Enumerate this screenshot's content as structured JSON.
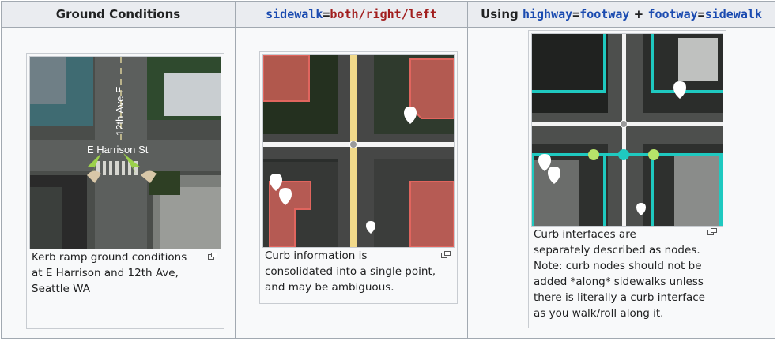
{
  "headers": {
    "col1": "Ground Conditions",
    "col2": {
      "key": "sidewalk",
      "eq": "=",
      "value": "both/right/left"
    },
    "col3": {
      "prefix": "Using ",
      "key1": "highway",
      "eq1": "=",
      "val1": "footway",
      "plus": " + ",
      "key2": "footway",
      "eq2": "=",
      "val2": "sidewalk"
    }
  },
  "figures": [
    {
      "street_label_vertical": "12th Ave E",
      "street_label_horizontal": "E Harrison St",
      "caption": [
        "Kerb ramp ground conditions",
        "at E Harrison and 12th Ave,",
        "Seattle WA"
      ]
    },
    {
      "caption": [
        "Curb information is",
        "consolidated into a single point,",
        "and may be ambiguous."
      ]
    },
    {
      "caption": [
        "Curb interfaces are",
        "separately described as nodes.",
        "Note: curb nodes should not be",
        "added *along* sidewalks unless",
        "there is literally a curb interface",
        "as you walk/roll along it."
      ]
    }
  ],
  "colors": {
    "key": "#1b4bb0",
    "value": "#a11d1d",
    "sidewalk_line": "#f1d98a",
    "footway": "#1fc9c0",
    "curb_node": "#b6e36a",
    "building": "#e0655e"
  }
}
